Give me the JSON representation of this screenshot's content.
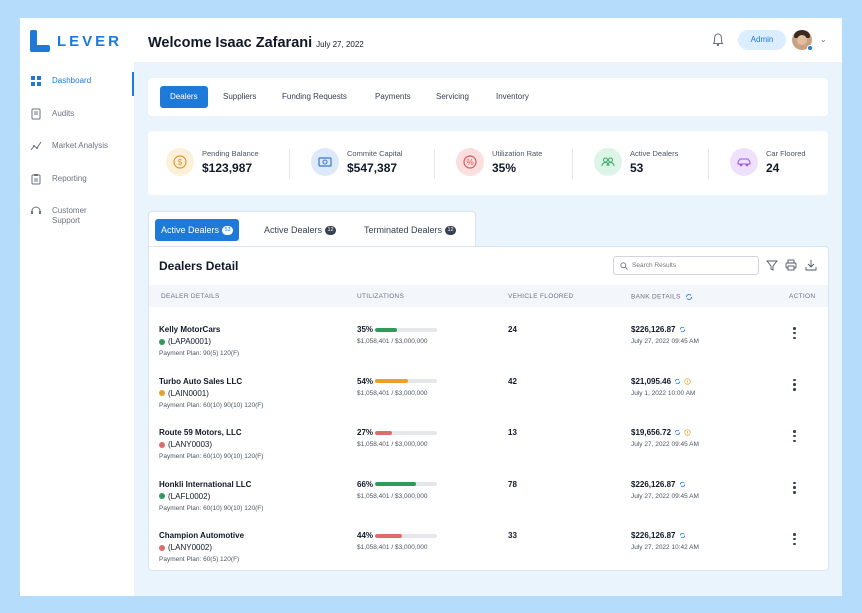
{
  "app": {
    "logo_text": "LEVER"
  },
  "sidebar": {
    "items": [
      {
        "label": "Dashboard",
        "icon": "grid-icon",
        "active": true
      },
      {
        "label": "Audits",
        "icon": "audit-document-icon",
        "active": false
      },
      {
        "label": "Market Analysis",
        "icon": "analytics-icon",
        "active": false
      },
      {
        "label": "Reporting",
        "icon": "clipboard-icon",
        "active": false
      },
      {
        "label": "Customer\nSupport",
        "icon": "headset-icon",
        "active": false
      }
    ]
  },
  "header": {
    "welcome": "Welcome Isaac Zafarani",
    "date": "July 27, 2022",
    "admin_label": "Admin",
    "icons": [
      "bell-icon",
      "avatar",
      "chevron-down-icon"
    ]
  },
  "tabs": [
    {
      "label": "Dealers",
      "active": true
    },
    {
      "label": "Suppliers"
    },
    {
      "label": "Funding Requests"
    },
    {
      "label": "Payments"
    },
    {
      "label": "Servicing"
    },
    {
      "label": "Inventory"
    }
  ],
  "stats": [
    {
      "label": "Pending Balance",
      "value": "$123,987",
      "icon": "dollar-coin-icon",
      "bg": "#fdf0d8",
      "fg": "#d99a2b"
    },
    {
      "label": "Commite Capital",
      "value": "$547,387",
      "icon": "cash-icon",
      "bg": "#dbe9fb",
      "fg": "#3b78c9"
    },
    {
      "label": "Utilization Rate",
      "value": "35%",
      "icon": "percent-icon",
      "bg": "#fbdede",
      "fg": "#d85a5a"
    },
    {
      "label": "Active Dealers",
      "value": "53",
      "icon": "users-icon",
      "bg": "#dcf5e8",
      "fg": "#3aa56c"
    },
    {
      "label": "Car Floored",
      "value": "24",
      "icon": "car-icon",
      "bg": "#efe1fb",
      "fg": "#9a5bd6"
    }
  ],
  "detail_tabs": [
    {
      "label": "Active Dealers",
      "count": "53",
      "active": true
    },
    {
      "label": "Active Dealers",
      "count": "12"
    },
    {
      "label": "Terminated Dealers",
      "count": "12"
    }
  ],
  "panel": {
    "title": "Dealers Detail",
    "search_placeholder": "Search Results",
    "tools": [
      "filter-icon",
      "print-icon",
      "download-icon"
    ]
  },
  "table": {
    "columns": [
      "DEALER DETAILS",
      "UTILIZATIONS",
      "VEHICLE FLOORED",
      "BANK DETAILS",
      "ACTION"
    ],
    "rows": [
      {
        "name": "Kelly MotorCars",
        "code": "(LAPA0001)",
        "status_color": "#2e9b5a",
        "plan": "Payment Plan: 90(5) 120(F)",
        "pct": "35%",
        "util": 0.35,
        "bar_color": "#2e9b5a",
        "amount": "$1,058,401 / $3,000,000",
        "vehicles": "24",
        "bank": "$226,126.87",
        "bank_icon": "sync-icon",
        "bank_date": "July 27, 2022 09:45 AM"
      },
      {
        "name": "Turbo Auto Sales LLC",
        "code": "(LAIN0001)",
        "status_color": "#e8a12d",
        "plan": "Payment Plan: 60(10) 90(10) 120(F)",
        "pct": "54%",
        "util": 0.54,
        "bar_color": "#e8a12d",
        "amount": "$1,058,401 / $3,000,000",
        "vehicles": "42",
        "bank": "$21,095.46",
        "bank_icon": "sync-warning-icon",
        "bank_date": "July 1, 2022 10:00 AM"
      },
      {
        "name": "Route 59 Motors, LLC",
        "code": "(LANY0003)",
        "status_color": "#e06b6b",
        "plan": "Payment Plan: 60(10) 90(10) 120(F)",
        "pct": "27%",
        "util": 0.27,
        "bar_color": "#e06b6b",
        "amount": "$1,058,401 / $3,000,000",
        "vehicles": "13",
        "bank": "$19,656.72",
        "bank_icon": "sync-warning-icon",
        "bank_date": "July 27, 2022 09:45 AM"
      },
      {
        "name": "Honkli International LLC",
        "code": "(LAFL0002)",
        "status_color": "#2e9b5a",
        "plan": "Payment Plan: 60(10) 90(10) 120(F)",
        "pct": "66%",
        "util": 0.66,
        "bar_color": "#2e9b5a",
        "amount": "$1,058,401 / $3,000,000",
        "vehicles": "78",
        "bank": "$226,126.87",
        "bank_icon": "sync-icon",
        "bank_date": "July 27, 2022 09:45 AM"
      },
      {
        "name": "Champion Automotive",
        "code": "(LANY0002)",
        "status_color": "#e06b6b",
        "plan": "Payment Plan: 60(5) 120(F)",
        "pct": "44%",
        "util": 0.44,
        "bar_color": "#e06b6b",
        "amount": "$1,058,401 / $3,000,000",
        "vehicles": "33",
        "bank": "$226,126.87",
        "bank_icon": "sync-icon",
        "bank_date": "July 27, 2022 10:42 AM"
      }
    ]
  },
  "colors": {
    "accent": "#1e7ad8",
    "background": "#b5dcfa"
  }
}
